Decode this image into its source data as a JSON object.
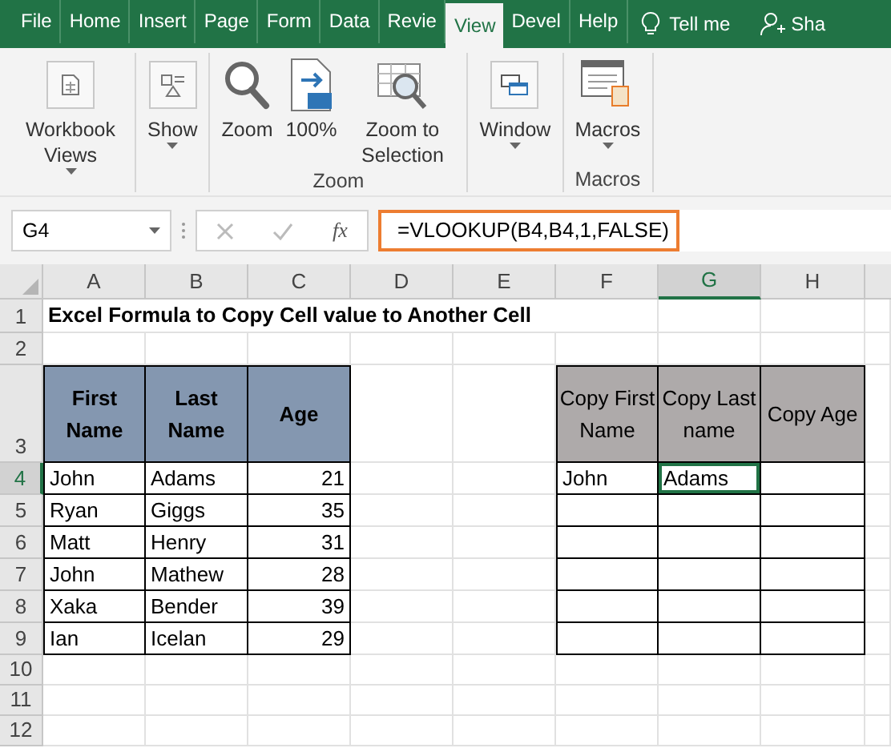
{
  "tabs": [
    {
      "label": "File",
      "selected": false
    },
    {
      "label": "Home",
      "selected": false
    },
    {
      "label": "Insert",
      "selected": false
    },
    {
      "label": "Page",
      "selected": false
    },
    {
      "label": "Form",
      "selected": false
    },
    {
      "label": "Data",
      "selected": false
    },
    {
      "label": "Revie",
      "selected": false
    },
    {
      "label": "View",
      "selected": true
    },
    {
      "label": "Devel",
      "selected": false
    },
    {
      "label": "Help",
      "selected": false
    }
  ],
  "tell_me": "Tell me",
  "share": "Sha",
  "ribbon": {
    "groups": [
      {
        "buttons": [
          {
            "kind": "workbook",
            "label": "Workbook Views",
            "dropdown": true
          }
        ]
      },
      {
        "buttons": [
          {
            "kind": "show",
            "label": "Show",
            "dropdown": true
          }
        ]
      },
      {
        "label": "Zoom",
        "buttons": [
          {
            "kind": "zoom",
            "label": "Zoom",
            "dropdown": false
          },
          {
            "kind": "hundred",
            "label": "100%",
            "dropdown": false
          },
          {
            "kind": "selection",
            "label": "Zoom to Selection",
            "dropdown": false
          }
        ]
      },
      {
        "buttons": [
          {
            "kind": "window",
            "label": "Window",
            "dropdown": true
          }
        ]
      },
      {
        "label": "Macros",
        "buttons": [
          {
            "kind": "macros",
            "label": "Macros",
            "dropdown": true
          }
        ]
      }
    ]
  },
  "formula_bar": {
    "name_box": "G4",
    "fx": "fx",
    "formula": "=VLOOKUP(B4,B4,1,FALSE)"
  },
  "sheet": {
    "columns": [
      {
        "label": "A",
        "selected": false
      },
      {
        "label": "B",
        "selected": false
      },
      {
        "label": "C",
        "selected": false
      },
      {
        "label": "D",
        "selected": false
      },
      {
        "label": "E",
        "selected": false
      },
      {
        "label": "F",
        "selected": false
      },
      {
        "label": "G",
        "selected": true
      },
      {
        "label": "H",
        "selected": false
      }
    ],
    "rows": [
      {
        "label": "1",
        "selected": false
      },
      {
        "label": "2",
        "selected": false
      },
      {
        "label": "3",
        "selected": false
      },
      {
        "label": "4",
        "selected": true
      },
      {
        "label": "5",
        "selected": false
      },
      {
        "label": "6",
        "selected": false
      },
      {
        "label": "7",
        "selected": false
      },
      {
        "label": "8",
        "selected": false
      },
      {
        "label": "9",
        "selected": false
      },
      {
        "label": "10",
        "selected": false
      },
      {
        "label": "11",
        "selected": false
      },
      {
        "label": "12",
        "selected": false
      }
    ],
    "title": "Excel Formula to Copy Cell value to Another Cell",
    "source_table": {
      "columns": [
        "First Name",
        "Last Name",
        "Age"
      ],
      "rows": [
        [
          "John",
          "Adams",
          "21"
        ],
        [
          "Ryan",
          "Giggs",
          "35"
        ],
        [
          "Matt",
          "Henry",
          "31"
        ],
        [
          "John",
          "Mathew",
          "28"
        ],
        [
          "Xaka",
          "Bender",
          "39"
        ],
        [
          "Ian",
          "Icelan",
          "29"
        ]
      ]
    },
    "copy_table": {
      "columns": [
        "Copy First Name",
        "Copy Last name",
        "Copy Age"
      ],
      "rows": [
        {
          "cells": [
            {
              "value": "John",
              "selected": false
            },
            {
              "value": "Adams",
              "selected": true
            },
            {
              "selected": false
            }
          ]
        },
        {
          "cells": [
            {
              "selected": false
            },
            {
              "selected": false
            },
            {
              "selected": false
            }
          ]
        },
        {
          "cells": [
            {
              "selected": false
            },
            {
              "selected": false
            },
            {
              "selected": false
            }
          ]
        },
        {
          "cells": [
            {
              "selected": false
            },
            {
              "selected": false
            },
            {
              "selected": false
            }
          ]
        },
        {
          "cells": [
            {
              "selected": false
            },
            {
              "selected": false
            },
            {
              "selected": false
            }
          ]
        },
        {
          "cells": [
            {
              "selected": false
            },
            {
              "selected": false
            },
            {
              "selected": false
            }
          ]
        }
      ]
    }
  }
}
